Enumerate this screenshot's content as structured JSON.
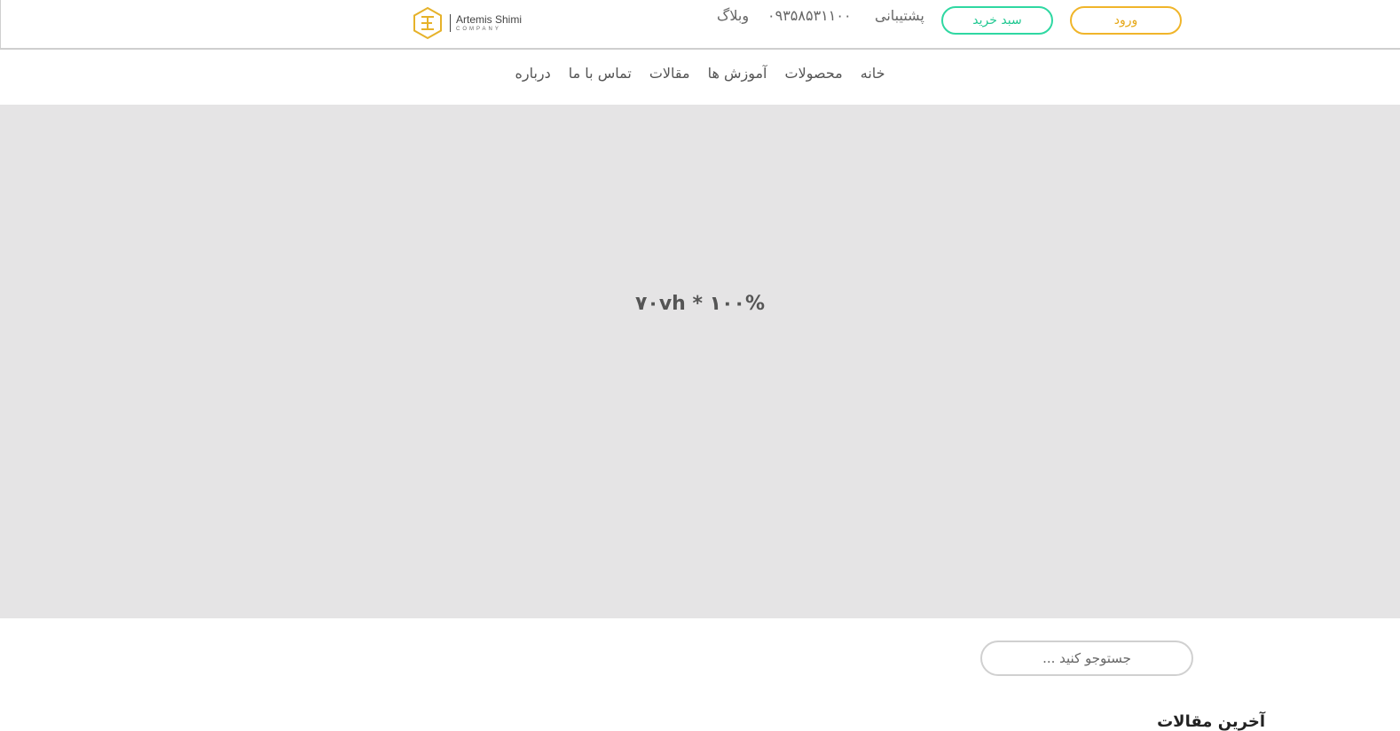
{
  "header": {
    "login_label": "ورود",
    "cart_label": "سبد خرید",
    "support_label": "پشتیبانی",
    "phone": "۰۹۳۵۸۵۳۱۱۰۰",
    "blog_label": "وبلاگ",
    "logo": {
      "name": "Artemis Shimi",
      "sub": "COMPANY"
    }
  },
  "nav": {
    "items": [
      {
        "label": "خانه"
      },
      {
        "label": "محصولات"
      },
      {
        "label": "آموزش ها"
      },
      {
        "label": "مقالات"
      },
      {
        "label": "تماس با ما"
      },
      {
        "label": "درباره"
      }
    ]
  },
  "hero": {
    "text": "۷۰vh * ۱۰۰%"
  },
  "search": {
    "placeholder": "جستوجو کنید ..."
  },
  "sidebar": {
    "latest_articles_title": "آخرین مقالات"
  },
  "colors": {
    "login_accent": "#f0b52a",
    "cart_accent": "#2fd8a2",
    "hero_bg": "#e5e4e5"
  }
}
